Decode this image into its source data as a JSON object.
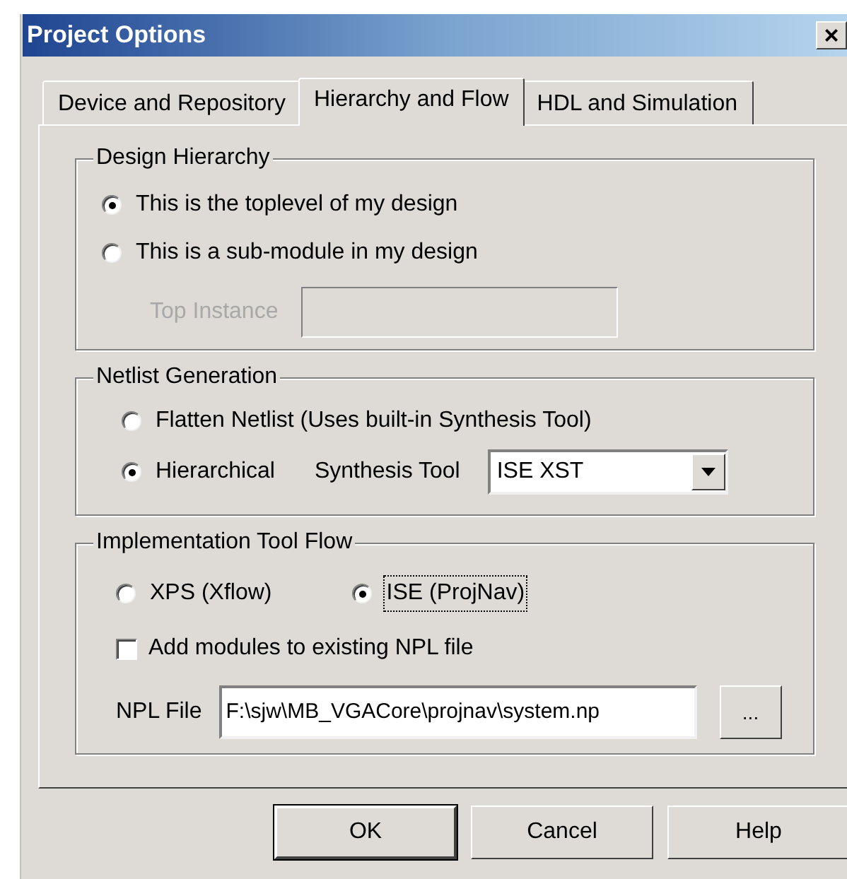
{
  "window": {
    "title": "Project Options",
    "close": "×"
  },
  "tabs": [
    {
      "label": "Device and Repository",
      "selected": false
    },
    {
      "label": "Hierarchy and Flow",
      "selected": true
    },
    {
      "label": "HDL and Simulation",
      "selected": false
    }
  ],
  "design_hierarchy": {
    "title": "Design Hierarchy",
    "options": [
      {
        "label": "This is the toplevel of my design",
        "selected": true
      },
      {
        "label": "This is a sub-module in my design",
        "selected": false
      }
    ],
    "top_instance": {
      "label": "Top Instance",
      "disabled": true
    }
  },
  "netlist_generation": {
    "title": "Netlist Generation",
    "options": [
      {
        "label": "Flatten Netlist (Uses built-in Synthesis Tool)",
        "selected": false
      },
      {
        "label": "Hierarchical",
        "selected": true
      }
    ],
    "synthesis_tool": {
      "label": "Synthesis Tool",
      "value": "ISE XST"
    }
  },
  "implementation_tool_flow": {
    "title": "Implementation Tool Flow",
    "options": [
      {
        "label": "XPS (Xflow)",
        "selected": false,
        "focused": false
      },
      {
        "label": "ISE (ProjNav)",
        "selected": true,
        "focused": true
      }
    ],
    "add_modules": {
      "label": "Add modules to existing NPL file",
      "checked": false
    },
    "npl_file": {
      "label": "NPL File",
      "value": "F:\\sjw\\MB_VGACore\\projnav\\system.np",
      "browse": "..."
    }
  },
  "buttons": [
    {
      "label": "OK",
      "default": true
    },
    {
      "label": "Cancel",
      "default": false
    },
    {
      "label": "Help",
      "default": false
    }
  ]
}
